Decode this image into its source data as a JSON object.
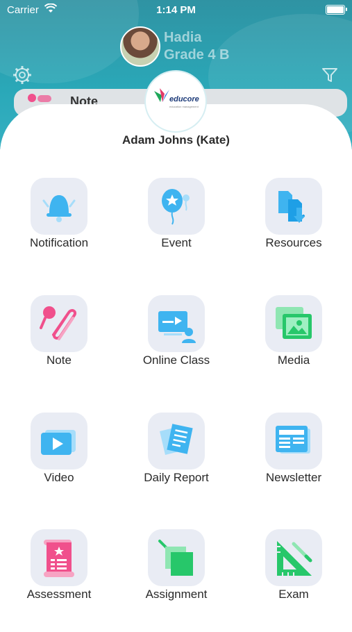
{
  "status_bar": {
    "carrier": "Carrier",
    "time": "1:14 PM"
  },
  "profile": {
    "name": "Hadia",
    "grade": "Grade 4 B"
  },
  "background_card": {
    "label": "Note"
  },
  "sheet": {
    "logo_text": "educore",
    "logo_tagline": "education management",
    "user_name": "Adam Johns (Kate)"
  },
  "menu": {
    "items": [
      {
        "label": "Notification",
        "icon": "bell-icon"
      },
      {
        "label": "Event",
        "icon": "balloon-icon"
      },
      {
        "label": "Resources",
        "icon": "documents-download-icon"
      },
      {
        "label": "Note",
        "icon": "pin-paperclip-icon"
      },
      {
        "label": "Online Class",
        "icon": "presentation-icon"
      },
      {
        "label": "Media",
        "icon": "gallery-icon"
      },
      {
        "label": "Video",
        "icon": "play-icon"
      },
      {
        "label": "Daily Report",
        "icon": "report-icon"
      },
      {
        "label": "Newsletter",
        "icon": "newsletter-icon"
      },
      {
        "label": "Assessment",
        "icon": "scroll-icon"
      },
      {
        "label": "Assignment",
        "icon": "assignment-icon"
      },
      {
        "label": "Exam",
        "icon": "ruler-square-icon"
      }
    ]
  },
  "colors": {
    "header": "#2aa8b8",
    "icon_blue": "#3fb4f0",
    "icon_pink": "#f0508c",
    "icon_green": "#27c76a",
    "tile_bg": "#e9ecf4"
  }
}
